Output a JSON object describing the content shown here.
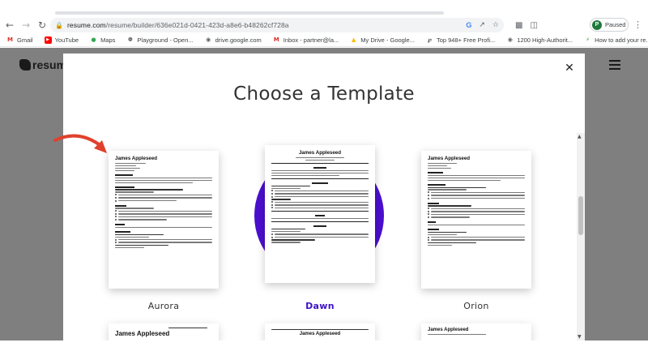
{
  "browser": {
    "url_host": "resume.com",
    "url_path": "/resume/builder/636e021d-0421-423d-a8e6-b48262cf728a",
    "profile_initial": "P",
    "profile_status": "Paused"
  },
  "bookmarks": [
    {
      "label": "Gmail",
      "icon": "gmail-icon",
      "color": "#d93025"
    },
    {
      "label": "YouTube",
      "icon": "youtube-icon",
      "color": "#ff0000"
    },
    {
      "label": "Maps",
      "icon": "maps-icon",
      "color": "#34a853"
    },
    {
      "label": "Playground - Open...",
      "icon": "openai-icon",
      "color": "#202124"
    },
    {
      "label": "drive.google.com",
      "icon": "globe-icon",
      "color": "#5f6368"
    },
    {
      "label": "Inbox - partner@la...",
      "icon": "gmail-icon",
      "color": "#d93025"
    },
    {
      "label": "My Drive - Google...",
      "icon": "drive-icon",
      "color": "#fbbc04"
    },
    {
      "label": "Top 948+ Free Profi...",
      "icon": "feed-icon",
      "color": "#202124"
    },
    {
      "label": "1200 High-Authorit...",
      "icon": "globe-icon",
      "color": "#5f6368"
    },
    {
      "label": "How to add your re...",
      "icon": "bolt-icon",
      "color": "#34a853"
    }
  ],
  "site": {
    "logo_text": "resum"
  },
  "modal": {
    "title": "Choose a Template",
    "close_glyph": "✕"
  },
  "templates": [
    {
      "name": "Aurora",
      "preview_name": "James Appleseed",
      "selected": false
    },
    {
      "name": "Dawn",
      "preview_name": "James Appleseed",
      "selected": true
    },
    {
      "name": "Orion",
      "preview_name": "James Appleseed",
      "selected": false
    }
  ],
  "next_row": [
    {
      "preview_name": "James Appleseed"
    },
    {
      "preview_name": "James Appleseed"
    },
    {
      "preview_name": "James Appleseed"
    }
  ],
  "colors": {
    "accent": "#3d11c7",
    "dawn_circle": "#4b0fcf",
    "overlay": "#7f7f7f",
    "arrow": "#e0412d"
  }
}
